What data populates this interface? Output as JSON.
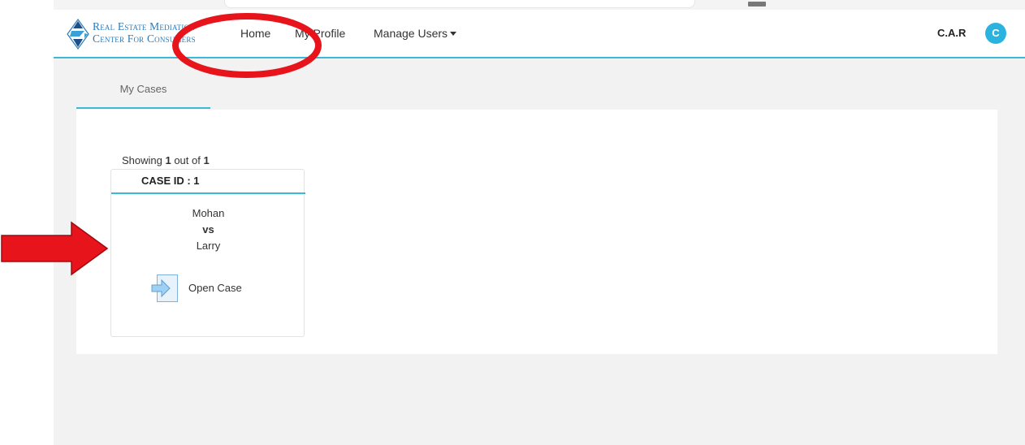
{
  "brand": {
    "line1": "Real Estate Mediation",
    "line2": "Center For Consumers",
    "logo_icon": "diamond-arrows-logo"
  },
  "nav": {
    "home": "Home",
    "profile": "My Profile",
    "manage_users": "Manage Users"
  },
  "user": {
    "name": "C.A.R",
    "avatar_initial": "C"
  },
  "tabs": {
    "my_cases": "My Cases"
  },
  "results": {
    "prefix": "Showing ",
    "current": "1",
    "middle": " out of ",
    "total": "1"
  },
  "case": {
    "id_label": "CASE ID : 1",
    "party_a": "Mohan",
    "vs": "vs",
    "party_b": "Larry",
    "open_label": "Open Case",
    "open_icon": "enter-arrow-icon"
  },
  "colors": {
    "accent": "#3cb9d6",
    "avatar": "#2ab3df",
    "annotation": "#e8141b"
  }
}
